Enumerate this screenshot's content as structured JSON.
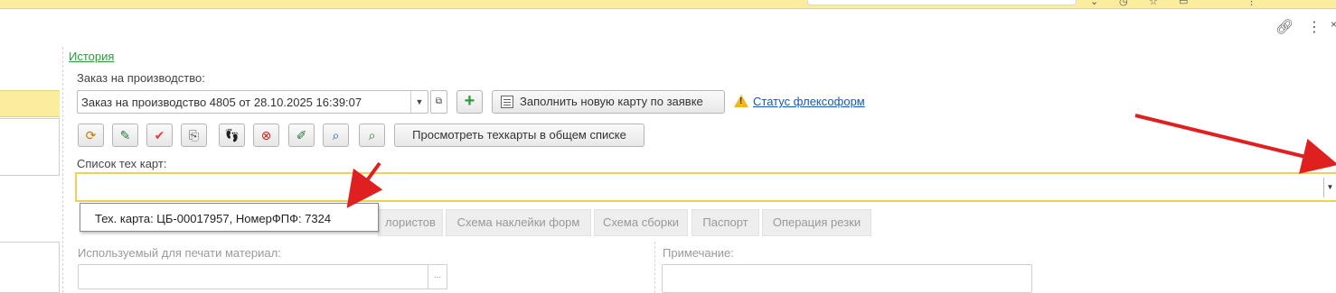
{
  "form": {
    "history_link": "История",
    "order_label": "Заказ на производство:",
    "order_value": "Заказ на производство 4805 от 28.10.2025 16:39:07",
    "add_label": "+",
    "fill_button": "Заполнить новую карту по заявке",
    "status_link": "Статус флексоформ",
    "view_button": "Просмотреть техкарты в общем списке",
    "techlist_label": "Список тех карт:",
    "techlist_value": "",
    "popup_option": "Тех. карта: ЦБ-00017957, НомерФПФ: 7324",
    "tabs": [
      {
        "label": "лористов"
      },
      {
        "label": "Схема наклейки форм"
      },
      {
        "label": "Схема сборки"
      },
      {
        "label": "Паспорт"
      },
      {
        "label": "Операция резки"
      }
    ],
    "print_material_label": "Используемый для печати материал:",
    "note_label": "Примечание:"
  },
  "toolbar_icons": [
    "refresh-icon",
    "save-edit-icon",
    "check-icon",
    "copy-icon",
    "footprints-icon",
    "cancel-icon",
    "edit-clock-icon",
    "search-add-icon",
    "search-check-icon"
  ],
  "colors": {
    "highlight": "#fbed9e",
    "focus_border": "#f2cf55",
    "link_green": "#2a9d3a",
    "link_blue": "#1a56b8",
    "annotation_arrow": "#e02020"
  }
}
